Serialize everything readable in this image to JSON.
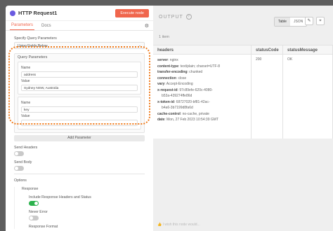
{
  "node": {
    "title": "HTTP Request1",
    "execute_label": "Execute node",
    "tabs": [
      {
        "label": "Parameters",
        "active": true
      },
      {
        "label": "Docs",
        "active": false
      }
    ]
  },
  "params": {
    "specify_label": "Specify Query Parameters",
    "specify_value": "Using Fields Below",
    "qp_title": "Query Parameters",
    "items": [
      {
        "name_label": "Name",
        "name_value": "address",
        "value_label": "Value",
        "value_value": "Sydney NSW, Australia"
      },
      {
        "name_label": "Name",
        "name_value": "key",
        "value_label": "Value",
        "value_value": ""
      }
    ],
    "add_param_label": "Add Parameter",
    "send_headers_label": "Send Headers",
    "send_body_label": "Send Body",
    "options_label": "Options",
    "response_label": "Response",
    "include_headers_label": "Include Response Headers and Status",
    "never_error_label": "Never Error",
    "response_format_label": "Response Format"
  },
  "output": {
    "title": "OUTPUT",
    "items_count": "1 item",
    "view_table": "Table",
    "view_json": "JSON",
    "columns": [
      "headers",
      "statusCode",
      "statusMessage"
    ],
    "status_code": "200",
    "status_message": "OK",
    "headers": [
      {
        "key": "server",
        "value": ": nginx",
        "indent": false
      },
      {
        "key": "content-type",
        "value": ": text/plain; charset=UTF-8",
        "indent": false
      },
      {
        "key": "transfer-encoding",
        "value": ": chunked",
        "indent": false
      },
      {
        "key": "connection",
        "value": ": close",
        "indent": false
      },
      {
        "key": "vary",
        "value": ": Accept-Encoding",
        "indent": false
      },
      {
        "key": "x-request-id",
        "value": ": 97c89efe-620c-4080-",
        "indent": false
      },
      {
        "key": "",
        "value": "b53a-439274ffe86d",
        "indent": true
      },
      {
        "key": "x-token-id",
        "value": ": 68727020-bf81-42ac-",
        "indent": false
      },
      {
        "key": "",
        "value": "b4a6-3b7199d8fa6d",
        "indent": true
      },
      {
        "key": "cache-control",
        "value": ": no-cache, private",
        "indent": false
      },
      {
        "key": "date",
        "value": ": Mon, 27 Feb 2023 10:54:39 GMT",
        "indent": false
      }
    ],
    "feedback": "I wish this node would..."
  },
  "colors": {
    "accent": "#f0664d",
    "highlight": "#f07a1a",
    "toggle_on": "#2bb24c"
  }
}
